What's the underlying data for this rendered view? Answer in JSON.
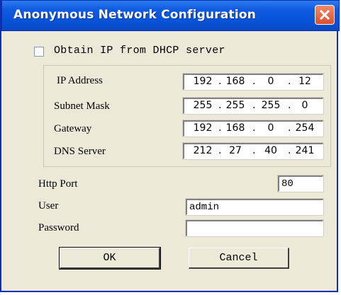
{
  "window": {
    "title": "Anonymous Network Configuration",
    "close_icon": "close-x-icon"
  },
  "dhcp": {
    "label": "Obtain IP from DHCP server",
    "checked": false
  },
  "network": {
    "ip_address": {
      "label": "IP Address",
      "octets": [
        "192",
        "168",
        "0",
        "12"
      ]
    },
    "subnet_mask": {
      "label": "Subnet Mask",
      "octets": [
        "255",
        "255",
        "255",
        "0"
      ]
    },
    "gateway": {
      "label": "Gateway",
      "octets": [
        "192",
        "168",
        "0",
        "254"
      ]
    },
    "dns_server": {
      "label": "DNS Server",
      "octets": [
        "212",
        "27",
        "40",
        "241"
      ]
    }
  },
  "http_port": {
    "label": "Http Port",
    "value": "80"
  },
  "user": {
    "label": "User",
    "value": "admin"
  },
  "password": {
    "label": "Password",
    "value": ""
  },
  "buttons": {
    "ok": "OK",
    "cancel": "Cancel"
  },
  "colors": {
    "titlebar": "#0553d8",
    "close_button": "#d9502e",
    "dialog_bg": "#ece9d8"
  }
}
